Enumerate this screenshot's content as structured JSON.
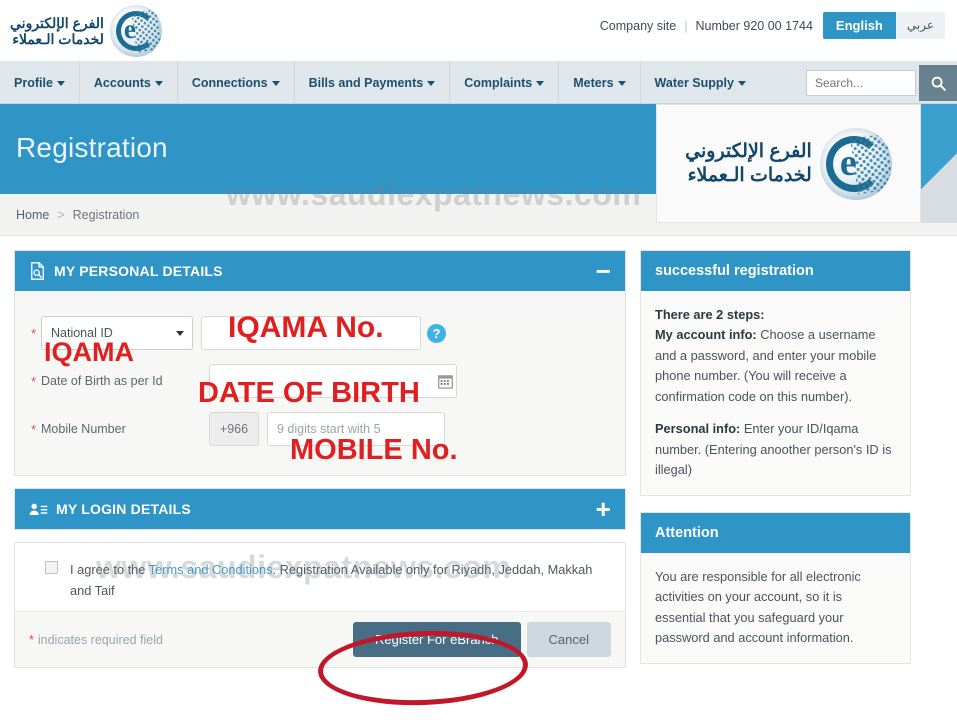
{
  "header": {
    "logo_ar_line1": "الفرع الإلكتروني",
    "logo_ar_line2": "لخدمات الـعملاء",
    "logo_mark": "e",
    "company_site": "Company site",
    "separator": "|",
    "phone": "Number 920 00 1744",
    "lang_en": "English",
    "lang_ar": "عربي"
  },
  "nav": {
    "items": [
      {
        "label": "Profile"
      },
      {
        "label": "Accounts"
      },
      {
        "label": "Connections"
      },
      {
        "label": "Bills and Payments"
      },
      {
        "label": "Complaints"
      },
      {
        "label": "Meters"
      },
      {
        "label": "Water Supply"
      }
    ],
    "search_placeholder": "Search...",
    "search_value": ""
  },
  "banner": {
    "title": "Registration",
    "logo_ar_line1": "الفرع الإلكتروني",
    "logo_ar_line2": "لخدمات الـعملاء",
    "logo_mark": "e"
  },
  "breadcrumb": {
    "home": "Home",
    "arrow": ">",
    "current": "Registration"
  },
  "personal": {
    "heading": "MY PERSONAL DETAILS",
    "toggle": "−",
    "id_type_value": "National ID",
    "id_placeholder": "",
    "help_glyph": "?",
    "dob_label": "Date of Birth as per Id",
    "dob_value": "",
    "mobile_label": "Mobile Number",
    "country_code": "+966",
    "mobile_placeholder": "9 digits start with 5",
    "required_star": "*"
  },
  "login": {
    "heading": "MY LOGIN DETAILS",
    "toggle": "+",
    "agree_prefix": "I agree to the ",
    "terms_link": "Terms and Conditions",
    "agree_suffix": ". Registration Available only for Riyadh, Jeddah, Makkah and Taif",
    "checkbox_checked": false
  },
  "footer": {
    "required_star": "*",
    "required_note": "indicates required field",
    "register_label": "Register For eBranch",
    "cancel_label": "Cancel"
  },
  "sidebar": {
    "success_panel": {
      "title": "successful registration",
      "steps_heading": "There are 2 steps:",
      "account_label": "My account info:",
      "account_text": " Choose a username and a password, and enter your mobile phone number. (You will receive a confirmation code on this number).",
      "personal_label": "Personal info:",
      "personal_text": " Enter your ID/Iqama number. (Entering anoother person's ID is illegal)"
    },
    "attention_panel": {
      "title": "Attention",
      "text": "You are responsible for all electronic activities on your account, so it is essential that you safeguard your password and account information."
    }
  },
  "annotations": {
    "iqama_no": "IQAMA No.",
    "iqama": "IQAMA",
    "dob": "DATE OF BIRTH",
    "mobile": "MOBILE No."
  },
  "watermark": {
    "text": "www.saudiexpatnews.com"
  },
  "colors": {
    "brand_blue": "#2e95c6",
    "nav_bg": "#dfe7ec",
    "nav_text": "#1c4f6e",
    "annotation_red": "#e02020",
    "circle_red": "#c0182a",
    "primary_button": "#486e86"
  }
}
